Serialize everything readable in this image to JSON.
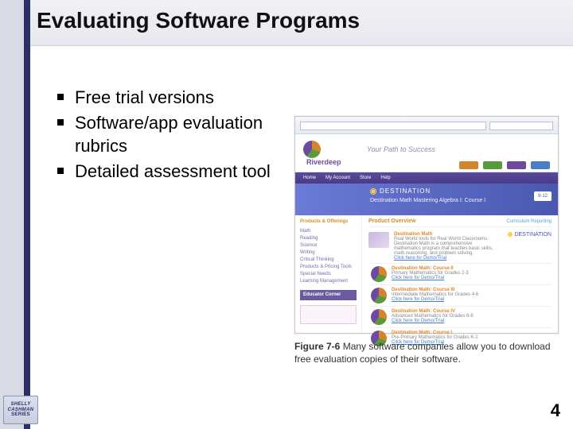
{
  "title": "Evaluating Software Programs",
  "bullets": [
    "Free trial versions",
    "Software/app evaluation rubrics",
    "Detailed assessment tool"
  ],
  "figure": {
    "label": "Figure 7-6",
    "caption_rest": " Many software companies allow you to download free evaluation copies of their software."
  },
  "page_number": "4",
  "series_badge": {
    "line1": "SHELLY",
    "line2": "CASHMAN",
    "line3": "SERIES"
  },
  "screenshot": {
    "brand": "Riverdeep",
    "tagline": "Your Path to Success",
    "nav": [
      "Home",
      "My Account",
      "Store",
      "Help"
    ],
    "promo_brand": "DESTINATION",
    "promo_sub": "Destination Math Mastering Algebra I: Course I",
    "promo_badge": "9-12",
    "sidebar_header": "Products & Offerings",
    "sidebar_items": [
      "Math",
      "Reading",
      "Science",
      "Writing",
      "Critical Thinking",
      "Products & Pricing Tools",
      "Special Needs",
      "Learning Management"
    ],
    "sidebar_edu": "Educator Corner",
    "content_header": "Product Overview",
    "content_links": "Curriculum   Reporting",
    "items": [
      {
        "title": "Destination Math",
        "desc": "Real World tools for Real World Classrooms. Destination Math is a comprehensive mathematics program that teaches basic skills, math reasoning, and problem solving.",
        "link": "Click here for Demo/Trial",
        "badge": "DESTINATION"
      },
      {
        "title": "Destination Math: Course II",
        "desc": "Primary Mathematics for Grades 2-3",
        "link": "Click here for Demo/Trial",
        "badge": ""
      },
      {
        "title": "Destination Math: Course III",
        "desc": "Intermediate Mathematics for Grades 4-6",
        "link": "Click here for Demo/Trial",
        "badge": ""
      },
      {
        "title": "Destination Math: Course IV",
        "desc": "Advanced Mathematics for Grades 6-8",
        "link": "Click here for Demo/Trial",
        "badge": ""
      },
      {
        "title": "Destination Math: Course I",
        "desc": "Pre-Primary Mathematics for Grades K-1",
        "link": "Click here for Demo/Trial",
        "badge": ""
      }
    ]
  }
}
